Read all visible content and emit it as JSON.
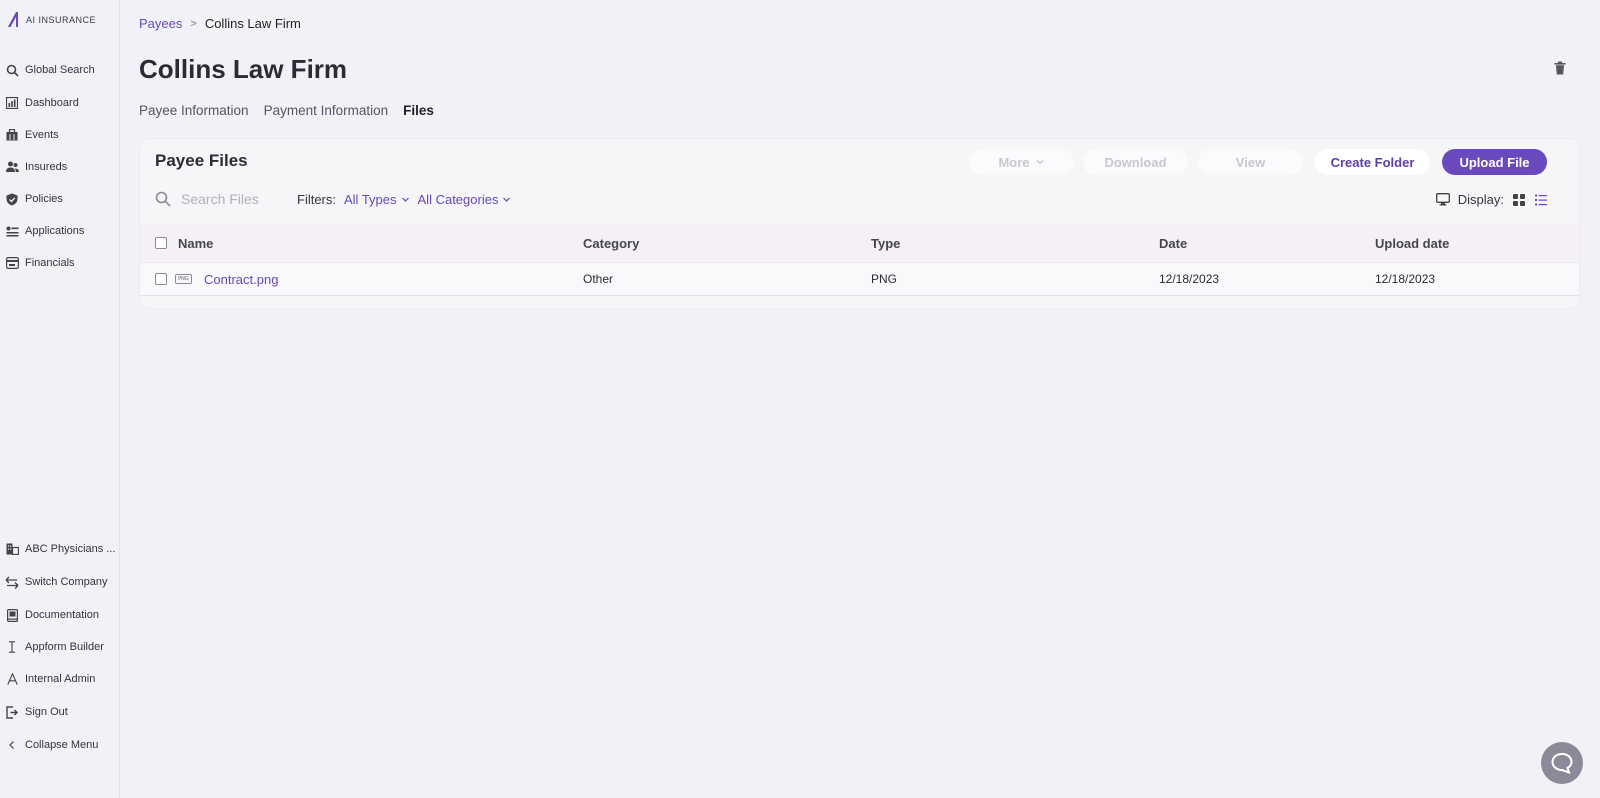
{
  "app": {
    "logo_text": "AI INSURANCE"
  },
  "sidebar": {
    "top_items": [
      {
        "label": "Global Search",
        "icon": "search-icon"
      },
      {
        "label": "Dashboard",
        "icon": "dashboard-icon"
      },
      {
        "label": "Events",
        "icon": "events-icon"
      },
      {
        "label": "Insureds",
        "icon": "insureds-icon"
      },
      {
        "label": "Policies",
        "icon": "shield-icon"
      },
      {
        "label": "Applications",
        "icon": "applications-icon"
      },
      {
        "label": "Financials",
        "icon": "financials-icon"
      }
    ],
    "bottom_items": [
      {
        "label": "ABC Physicians ...",
        "icon": "company-icon"
      },
      {
        "label": "Switch Company",
        "icon": "switch-icon"
      },
      {
        "label": "Documentation",
        "icon": "book-icon"
      },
      {
        "label": "Appform Builder",
        "icon": "text-cursor-icon"
      },
      {
        "label": "Internal Admin",
        "icon": "admin-icon"
      },
      {
        "label": "Sign Out",
        "icon": "sign-out-icon"
      },
      {
        "label": "Collapse Menu",
        "icon": "chevron-left-icon"
      }
    ]
  },
  "breadcrumb": {
    "parent": "Payees",
    "separator": ">",
    "current": "Collins Law Firm"
  },
  "page": {
    "title": "Collins Law Firm"
  },
  "tabs": [
    {
      "label": "Payee Information",
      "active": false
    },
    {
      "label": "Payment Information",
      "active": false
    },
    {
      "label": "Files",
      "active": true
    }
  ],
  "files": {
    "title": "Payee Files",
    "buttons": {
      "more": "More",
      "download": "Download",
      "view": "View",
      "create_folder": "Create Folder",
      "upload": "Upload File"
    },
    "search_placeholder": "Search Files",
    "filters_label": "Filters:",
    "filter_types": "All Types",
    "filter_categories": "All Categories",
    "display_label": "Display:",
    "columns": {
      "name": "Name",
      "category": "Category",
      "type": "Type",
      "date": "Date",
      "upload_date": "Upload date"
    },
    "rows": [
      {
        "badge": "PNG",
        "name": "Contract.png",
        "category": "Other",
        "type": "PNG",
        "date": "12/18/2023",
        "upload_date": "12/18/2023"
      }
    ]
  },
  "colors": {
    "accent": "#6a49bf",
    "link": "#6848b6",
    "background": "#f1f2f7"
  }
}
